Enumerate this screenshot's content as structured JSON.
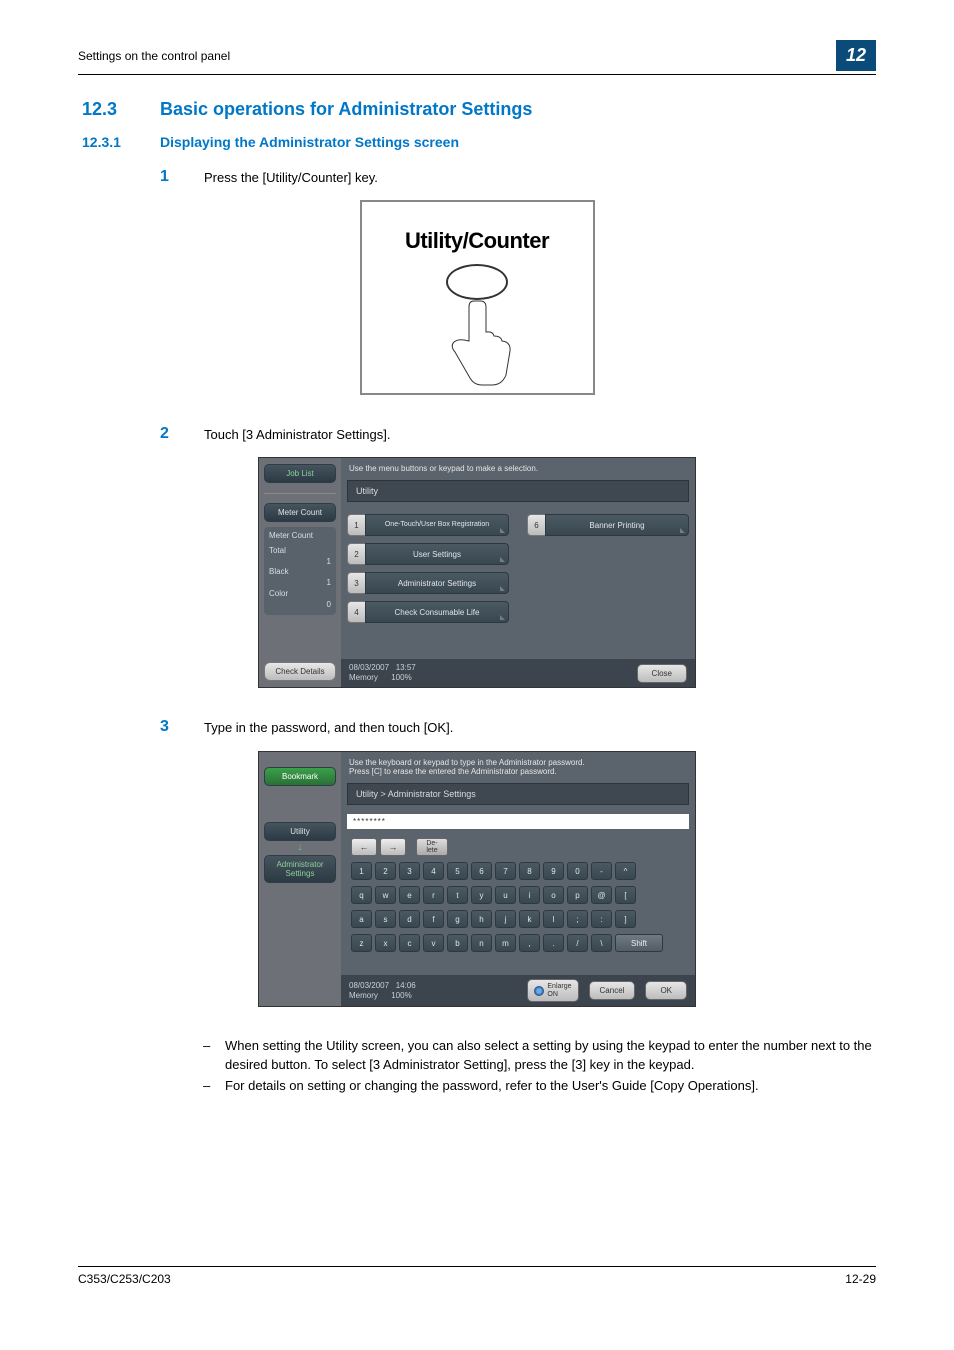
{
  "header": {
    "text": "Settings on the control panel",
    "badge": "12"
  },
  "section": {
    "number": "12.3",
    "title": "Basic operations for Administrator Settings"
  },
  "subsection": {
    "number": "12.3.1",
    "title": "Displaying the Administrator Settings screen"
  },
  "steps": {
    "s1": {
      "n": "1",
      "text": "Press the [Utility/Counter] key."
    },
    "s2": {
      "n": "2",
      "text": "Touch [3 Administrator Settings]."
    },
    "s3": {
      "n": "3",
      "text": "Type in the password, and then touch [OK]."
    }
  },
  "util_counter": {
    "title": "Utility/Counter"
  },
  "panel1": {
    "left": {
      "job_list": "Job List",
      "meter_count_tab": "Meter Count",
      "meter_title": "Meter Count",
      "total_label": "Total",
      "total_val": "1",
      "black_label": "Black",
      "black_val": "1",
      "color_label": "Color",
      "color_val": "0",
      "check_details": "Check Details"
    },
    "msg": "Use the menu buttons or keypad to make a selection.",
    "breadcrumb": "Utility",
    "menu": {
      "m1": {
        "idx": "1",
        "label": "One-Touch/User Box\nRegistration"
      },
      "m6": {
        "idx": "6",
        "label": "Banner Printing"
      },
      "m2": {
        "idx": "2",
        "label": "User Settings"
      },
      "m3": {
        "idx": "3",
        "label": "Administrator Settings"
      },
      "m4": {
        "idx": "4",
        "label": "Check Consumable Life"
      }
    },
    "status": {
      "date": "08/03/2007",
      "time": "13:57",
      "mem_label": "Memory",
      "mem_val": "100%",
      "close": "Close"
    }
  },
  "panel2": {
    "left": {
      "bookmark": "Bookmark",
      "utility": "Utility",
      "admin": "Administrator\nSettings"
    },
    "msg1": "Use the keyboard or keypad to type in the Administrator password.",
    "msg2": "Press [C] to erase the entered the Administrator password.",
    "breadcrumb": "Utility  >  Administrator Settings",
    "password_masked": "********",
    "nav": {
      "left": "←",
      "right": "→",
      "delete": "De-\nlete"
    },
    "rows": {
      "r1": [
        "1",
        "2",
        "3",
        "4",
        "5",
        "6",
        "7",
        "8",
        "9",
        "0",
        "-",
        "^"
      ],
      "r2": [
        "q",
        "w",
        "e",
        "r",
        "t",
        "y",
        "u",
        "i",
        "o",
        "p",
        "@",
        "["
      ],
      "r3": [
        "a",
        "s",
        "d",
        "f",
        "g",
        "h",
        "j",
        "k",
        "l",
        ";",
        ":",
        "]"
      ],
      "r4": [
        "z",
        "x",
        "c",
        "v",
        "b",
        "n",
        "m",
        ",",
        ".",
        "/",
        "\\"
      ]
    },
    "shift": "Shift",
    "enlarge": "Enlarge\nON",
    "cancel": "Cancel",
    "ok": "OK",
    "status": {
      "date": "08/03/2007",
      "time": "14:06",
      "mem_label": "Memory",
      "mem_val": "100%"
    }
  },
  "notes": {
    "n1": "When setting the Utility screen, you can also select a setting by using the keypad to enter the number next to the desired button. To select [3 Administrator Setting], press the [3] key in the keypad.",
    "n2": "For details on setting or changing the password, refer to the User's Guide [Copy Operations]."
  },
  "footer": {
    "left": "C353/C253/C203",
    "right": "12-29"
  }
}
